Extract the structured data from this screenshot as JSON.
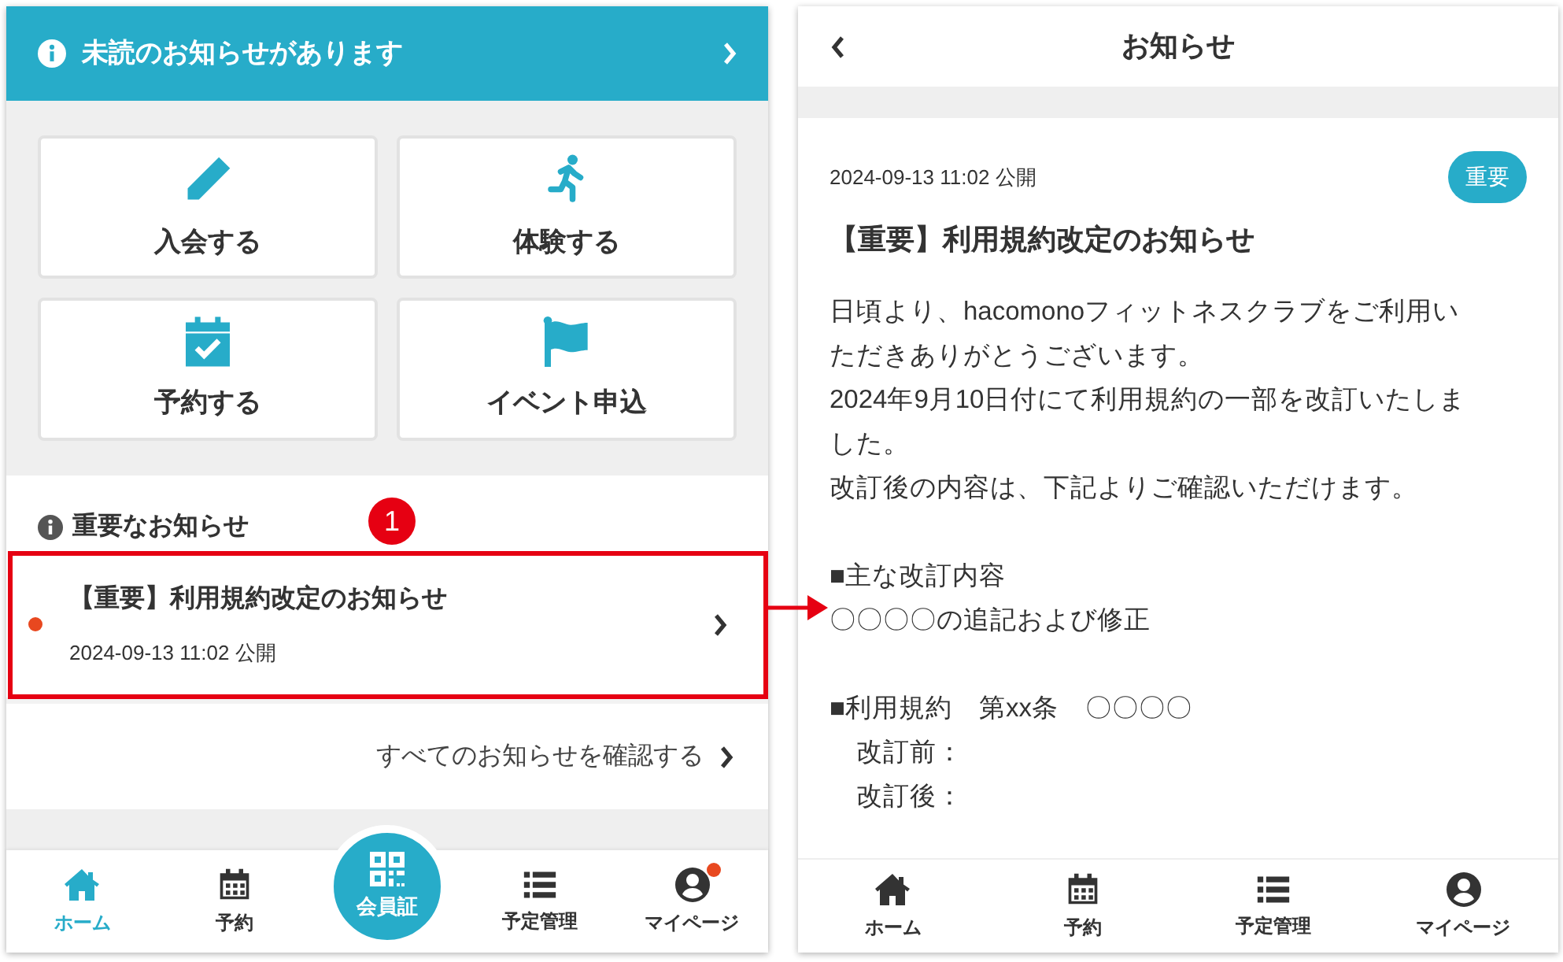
{
  "left_screen": {
    "banner": {
      "text": "未読のお知らせがあります"
    },
    "tiles": [
      {
        "label": "入会する"
      },
      {
        "label": "体験する"
      },
      {
        "label": "予約する"
      },
      {
        "label": "イベント申込"
      }
    ],
    "important": {
      "heading": "重要なお知らせ",
      "items": [
        {
          "title": "【重要】利用規約改定のお知らせ",
          "date": "2024-09-13 11:02 公開",
          "unread": true
        }
      ]
    },
    "view_all": "すべてのお知らせを確認する",
    "tab_bar": [
      {
        "kind": "tab",
        "label": "ホーム",
        "selected": true,
        "dot": false
      },
      {
        "kind": "tab",
        "label": "予約",
        "selected": false,
        "dot": false
      },
      {
        "kind": "center",
        "label": "会員証",
        "selected": false
      },
      {
        "kind": "tab",
        "label": "予定管理",
        "selected": false,
        "dot": false
      },
      {
        "kind": "tab",
        "label": "マイページ",
        "selected": false,
        "dot": true
      }
    ]
  },
  "annotation": {
    "number": "1"
  },
  "right_screen": {
    "title": "お知らせ",
    "date": "2024-09-13 11:02 公開",
    "badge": "重要",
    "heading": "【重要】利用規約改定のお知らせ",
    "sections": [
      [
        {
          "kind": "text",
          "text": "日頃より、hacomonoフィットネスクラブをご利用いただきありがとうございます。"
        },
        {
          "kind": "text",
          "text": "2024年9月10日付にて利用規約の一部を改訂いたしました。"
        },
        {
          "kind": "text",
          "text": "改訂後の内容は、下記よりご確認いただけます。"
        }
      ],
      [
        {
          "kind": "text",
          "text": "■主な改訂内容"
        },
        {
          "kind": "text",
          "text": "〇〇〇〇の追記および修正"
        }
      ],
      [
        {
          "kind": "text",
          "text": "■利用規約　第xx条　〇〇〇〇"
        },
        {
          "kind": "sub",
          "text": "改訂前："
        },
        {
          "kind": "sub",
          "text": "改訂後："
        }
      ]
    ],
    "tab_bar": [
      {
        "kind": "tab",
        "label": "ホーム",
        "selected": false,
        "dot": false
      },
      {
        "kind": "tab",
        "label": "予約",
        "selected": false,
        "dot": false
      },
      {
        "kind": "tab",
        "label": "予定管理",
        "selected": false,
        "dot": false
      },
      {
        "kind": "tab",
        "label": "マイページ",
        "selected": false,
        "dot": false
      }
    ]
  }
}
